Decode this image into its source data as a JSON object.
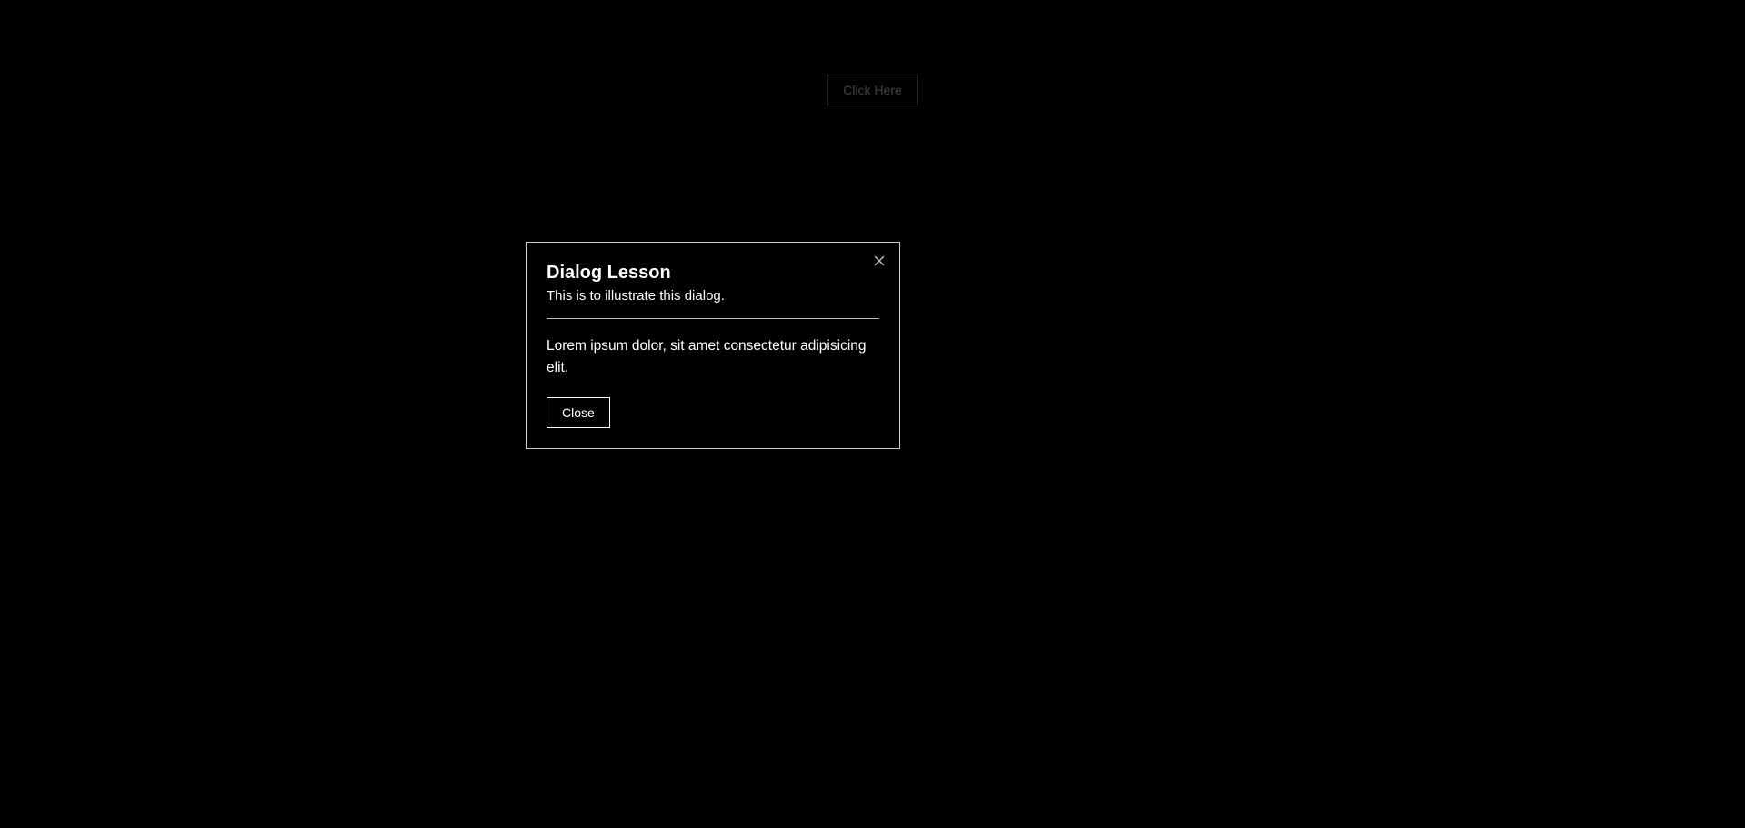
{
  "trigger": {
    "label": "Click Here"
  },
  "dialog": {
    "title": "Dialog Lesson",
    "subtitle": "This is to illustrate this dialog.",
    "body": "Lorem ipsum dolor, sit amet consectetur adipisicing elit.",
    "close_label": "Close"
  }
}
